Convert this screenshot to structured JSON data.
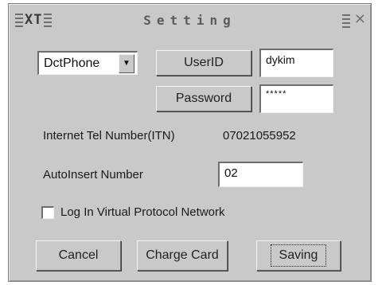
{
  "window": {
    "logo_text": "XT",
    "title": "Setting",
    "menu_icon": "menu-lines-icon",
    "close_glyph": "×"
  },
  "form": {
    "device_select": {
      "selected": "DctPhone"
    },
    "userid_button": "UserID",
    "userid_value": "dykim",
    "password_button": "Password",
    "password_value": "*****",
    "itn_label": "Internet Tel Number(ITN)",
    "itn_value": "07021055952",
    "autoinsert_label": "AutoInsert Number",
    "autoinsert_value": "02",
    "checkbox": {
      "label": "Log In Virtual Protocol Network",
      "checked": false
    }
  },
  "buttons": {
    "cancel": "Cancel",
    "charge_card": "Charge Card",
    "saving": "Saving"
  }
}
